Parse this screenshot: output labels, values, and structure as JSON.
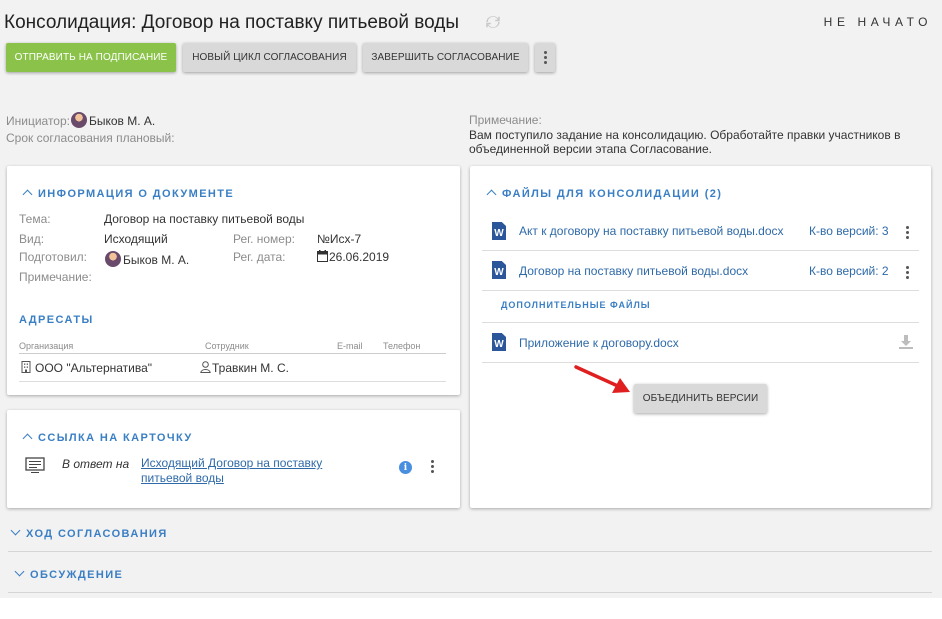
{
  "header": {
    "title": "Консолидация: Договор на поставку питьевой воды",
    "status": "НЕ НАЧАТО"
  },
  "toolbar": {
    "send_label": "ОТПРАВИТЬ НА ПОДПИСАНИЕ",
    "new_cycle_label": "НОВЫЙ ЦИКЛ СОГЛАСОВАНИЯ",
    "finish_label": "ЗАВЕРШИТЬ СОГЛАСОВАНИЕ"
  },
  "meta": {
    "initiator_label": "Инициатор:",
    "initiator_value": "Быков М. А.",
    "deadline_label": "Срок согласования плановый:",
    "note_label": "Примечание:",
    "note_text_1": "Вам поступило задание на консолидацию. Обработайте правки участников в",
    "note_text_2": "объединенной версии этапа Согласование."
  },
  "doc_info": {
    "title": "ИНФОРМАЦИЯ О ДОКУМЕНТЕ",
    "subject_label": "Тема:",
    "subject_value": "Договор на поставку питьевой воды",
    "kind_label": "Вид:",
    "kind_value": "Исходящий",
    "prepared_label": "Подготовил:",
    "prepared_value": "Быков М. А.",
    "note_label": "Примечание:",
    "reg_num_label": "Рег. номер:",
    "reg_num_value": "№Исх-7",
    "reg_date_label": "Рег. дата:",
    "reg_date_value": "26.06.2019"
  },
  "addressees": {
    "title": "АДРЕСАТЫ",
    "columns": [
      "Организация",
      "Сотрудник",
      "E-mail",
      "Телефон"
    ],
    "rows": [
      {
        "org": "ООО \"Альтернатива\"",
        "employee": "Травкин М. С.",
        "email": "",
        "phone": ""
      }
    ]
  },
  "card_link": {
    "title": "ССЫЛКА НА КАРТОЧКУ",
    "relation": "В ответ на",
    "link_line1": "Исходящий Договор на поставку",
    "link_line2": "питьевой воды"
  },
  "files": {
    "title": "ФАЙЛЫ ДЛЯ КОНСОЛИДАЦИИ (2)",
    "items": [
      {
        "name": "Акт к договору на поставку питьевой воды.docx",
        "versions": "К-во версий: 3"
      },
      {
        "name": "Договор на поставку питьевой воды.docx",
        "versions": "К-во версий: 2"
      }
    ],
    "additional_title": "ДОПОЛНИТЕЛЬНЫЕ ФАЙЛЫ",
    "additional_items": [
      {
        "name": "Приложение к договору.docx"
      }
    ],
    "merge_label": "ОБЪЕДИНИТЬ ВЕРСИИ"
  },
  "sections": {
    "approval_progress": "ХОД СОГЛАСОВАНИЯ",
    "discussion": "ОБСУЖДЕНИЕ"
  },
  "icons": {
    "refresh": "refresh-icon",
    "word": "word-file-icon",
    "download": "download-icon",
    "calendar": "calendar-icon",
    "building": "building-icon",
    "person": "person-icon",
    "card": "card-icon",
    "info": "info-icon",
    "arrow": "red-arrow-icon"
  },
  "colors": {
    "accent": "#3a7fc4",
    "primary_button": "#8bc34a",
    "word": "#2b579a",
    "annotation_arrow": "#e02020"
  }
}
